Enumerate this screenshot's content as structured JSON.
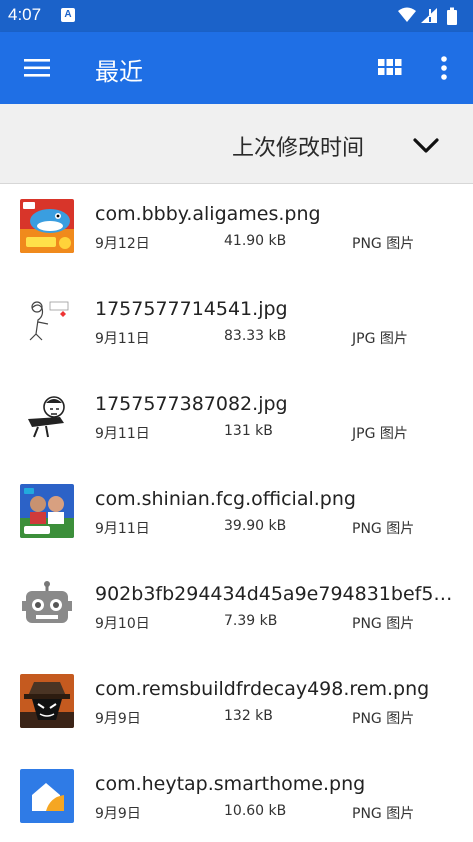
{
  "status_bar": {
    "time": "4:07",
    "notification": "A"
  },
  "app_bar": {
    "title": "最近"
  },
  "sort": {
    "label": "上次修改时间"
  },
  "files": [
    {
      "name": "com.bbby.aligames.png",
      "date": "9月12日",
      "size": "41.90 kB",
      "type": "PNG 图片",
      "thumb": "game-shark-thumbnail"
    },
    {
      "name": "1757577714541.jpg",
      "date": "9月11日",
      "size": "83.33 kB",
      "type": "JPG 图片",
      "thumb": "sketch-meme-thumbnail"
    },
    {
      "name": "1757577387082.jpg",
      "date": "9月11日",
      "size": "131 kB",
      "type": "JPG 图片",
      "thumb": "sketch-face-thumbnail"
    },
    {
      "name": "com.shinian.fcg.official.png",
      "date": "9月11日",
      "size": "39.90 kB",
      "type": "PNG 图片",
      "thumb": "soccer-game-thumbnail"
    },
    {
      "name": "902b3fb294434d45a9e794831bef5…",
      "date": "9月10日",
      "size": "7.39 kB",
      "type": "PNG 图片",
      "thumb": "robot-icon"
    },
    {
      "name": "com.remsbuildfrdecay498.rem.png",
      "date": "9月9日",
      "size": "132 kB",
      "type": "PNG 图片",
      "thumb": "hat-character-thumbnail"
    },
    {
      "name": "com.heytap.smarthome.png",
      "date": "9月9日",
      "size": "10.60 kB",
      "type": "PNG 图片",
      "thumb": "smart-home-thumbnail"
    }
  ],
  "colors": {
    "status_bar": "#1b62c9",
    "app_bar": "#1f6fe5",
    "sort_bar": "#f0f0f0"
  }
}
